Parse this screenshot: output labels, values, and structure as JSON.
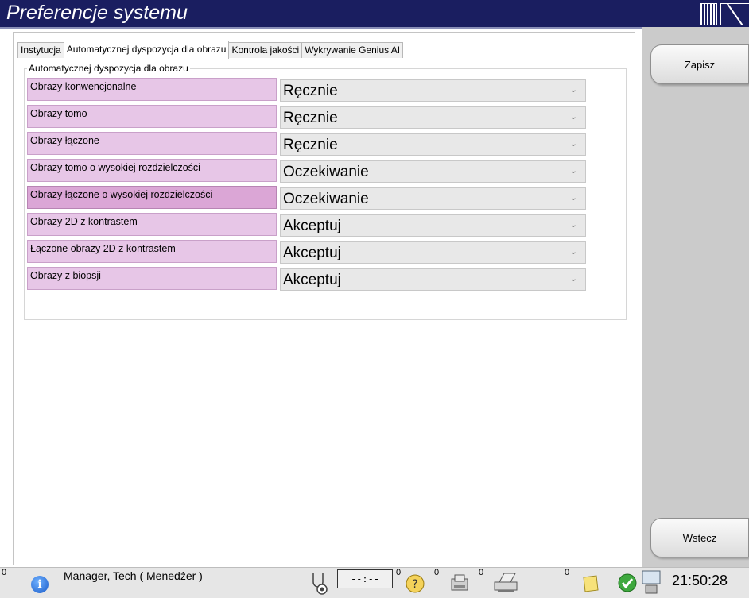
{
  "window": {
    "title": "Preferencje systemu"
  },
  "tabs": [
    {
      "label": "Instytucja",
      "active": false
    },
    {
      "label": "Automatycznej dyspozycja dla obrazu",
      "active": true
    },
    {
      "label": "Kontrola jakości",
      "active": false
    },
    {
      "label": "Wykrywanie Genius AI",
      "active": false
    }
  ],
  "group": {
    "title": "Automatycznej dyspozycja dla obrazu",
    "rows": [
      {
        "label": "Obrazy konwencjonalne",
        "value": "Ręcznie"
      },
      {
        "label": "Obrazy tomo",
        "value": "Ręcznie"
      },
      {
        "label": "Obrazy łączone",
        "value": "Ręcznie"
      },
      {
        "label": "Obrazy tomo o wysokiej rozdzielczości",
        "value": "Oczekiwanie"
      },
      {
        "label": "Obrazy łączone o wysokiej rozdzielczości",
        "value": "Oczekiwanie",
        "selected": true
      },
      {
        "label": "Obrazy 2D z kontrastem",
        "value": "Akceptuj"
      },
      {
        "label": "Łączone obrazy 2D z kontrastem",
        "value": "Akceptuj"
      },
      {
        "label": "Obrazy z biopsji",
        "value": "Akceptuj"
      }
    ]
  },
  "side_buttons": {
    "save": "Zapisz",
    "back": "Wstecz"
  },
  "statusbar": {
    "left_count": "0",
    "user": "Manager, Tech ( Menedżer )",
    "timer": "--:--",
    "counts": [
      "0",
      "0",
      "0",
      "0"
    ],
    "clock": "21:50:28"
  },
  "colors": {
    "titlebar": "#1a1e60",
    "row_label": "#e7c6e7",
    "row_label_selected": "#dba6d6",
    "select_bg": "#e8e8e8",
    "right_panel": "#cbcbcb"
  }
}
